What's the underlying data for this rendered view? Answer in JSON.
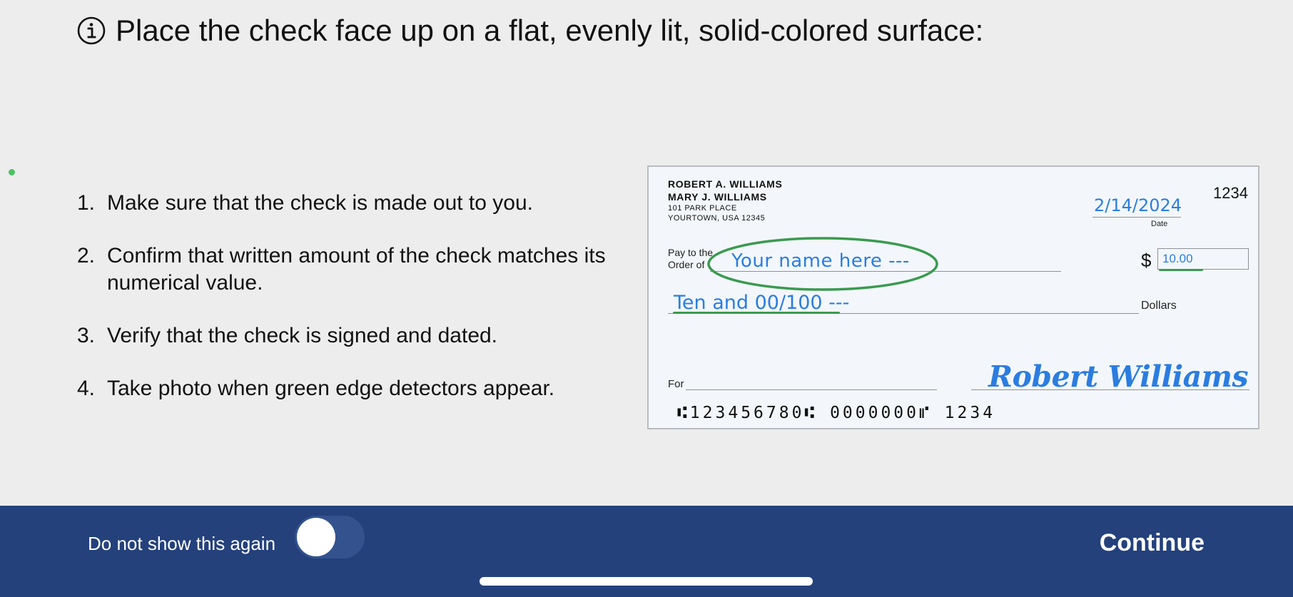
{
  "header": {
    "icon": "info-circle-icon",
    "title": "Place the check face up on a flat, evenly lit, solid-colored surface:"
  },
  "steps": [
    {
      "num": "1.",
      "text": "Make sure that the check is made out to you."
    },
    {
      "num": "2.",
      "text": "Confirm that written amount of the check matches its numerical value."
    },
    {
      "num": "3.",
      "text": "Verify that the check is signed and dated."
    },
    {
      "num": "4.",
      "text": "Take photo when green edge detectors appear."
    }
  ],
  "check": {
    "payer_name_1": "ROBERT A. WILLIAMS",
    "payer_name_2": "MARY J. WILLIAMS",
    "address_1": "101 PARK PLACE",
    "address_2": "YOURTOWN, USA 12345",
    "check_number": "1234",
    "date_value": "2/14/2024",
    "date_label": "Date",
    "pay_to_label_1": "Pay to the",
    "pay_to_label_2": "Order of",
    "payee_value": "Your name here ---",
    "dollar_sign": "$",
    "amount_value": "10.00",
    "written_amount": "Ten and 00/100 ---",
    "dollars_label": "Dollars",
    "for_label": "For",
    "signature": "Robert Williams",
    "micr_line": "⑆123456780⑆   0000000⑈  1234"
  },
  "footer": {
    "dont_show_label": "Do not show this again",
    "toggle_on": false,
    "continue_label": "Continue"
  },
  "colors": {
    "bottom_bar": "#24417c",
    "handwriting_blue": "#2b7de0",
    "highlight_green": "#3a9a50",
    "status_dot": "#4cc265"
  }
}
